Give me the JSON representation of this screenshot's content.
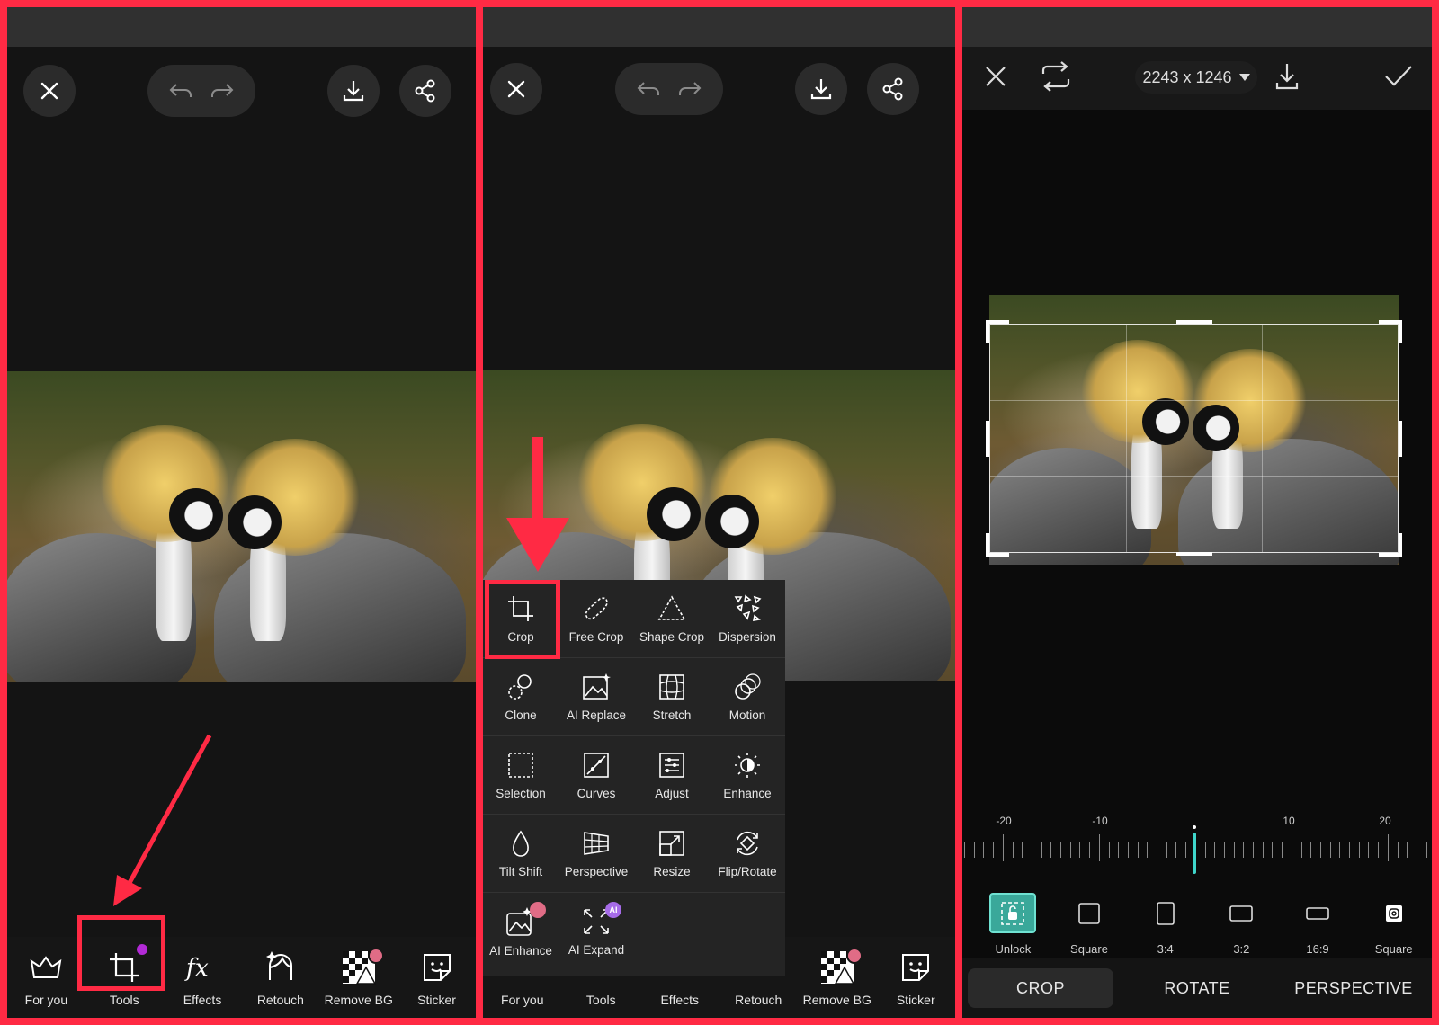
{
  "panel1": {
    "toolbar": [
      {
        "label": "For you",
        "icon": "crown-icon"
      },
      {
        "label": "Tools",
        "icon": "crop-icon"
      },
      {
        "label": "Effects",
        "icon": "fx-icon"
      },
      {
        "label": "Retouch",
        "icon": "face-icon"
      },
      {
        "label": "Remove BG",
        "icon": "checkerboard-icon"
      },
      {
        "label": "Sticker",
        "icon": "sticker-icon"
      }
    ]
  },
  "panel2": {
    "tools": [
      {
        "label": "Crop",
        "icon": "crop-icon"
      },
      {
        "label": "Free Crop",
        "icon": "free-crop-icon"
      },
      {
        "label": "Shape Crop",
        "icon": "triangle-icon"
      },
      {
        "label": "Dispersion",
        "icon": "dispersion-icon"
      },
      {
        "label": "Clone",
        "icon": "clone-icon"
      },
      {
        "label": "AI Replace",
        "icon": "ai-replace-icon"
      },
      {
        "label": "Stretch",
        "icon": "stretch-icon"
      },
      {
        "label": "Motion",
        "icon": "motion-icon"
      },
      {
        "label": "Selection",
        "icon": "selection-icon"
      },
      {
        "label": "Curves",
        "icon": "curves-icon"
      },
      {
        "label": "Adjust",
        "icon": "adjust-icon"
      },
      {
        "label": "Enhance",
        "icon": "enhance-icon"
      },
      {
        "label": "Tilt Shift",
        "icon": "drop-icon"
      },
      {
        "label": "Perspective",
        "icon": "perspective-icon"
      },
      {
        "label": "Resize",
        "icon": "resize-icon"
      },
      {
        "label": "Flip/Rotate",
        "icon": "flip-rotate-icon"
      },
      {
        "label": "AI Enhance",
        "icon": "ai-enhance-icon"
      },
      {
        "label": "AI Expand",
        "icon": "ai-expand-icon"
      }
    ],
    "ai_badge": "AI",
    "toolbar": [
      {
        "label": "For you"
      },
      {
        "label": "Tools"
      },
      {
        "label": "Effects"
      },
      {
        "label": "Retouch"
      },
      {
        "label": "Remove BG"
      },
      {
        "label": "Sticker"
      }
    ]
  },
  "panel3": {
    "image_size": "2243 x 1246",
    "ruler_labels": [
      "-20",
      "-10",
      "10",
      "20"
    ],
    "aspects": [
      {
        "label": "Unlock",
        "active": true
      },
      {
        "label": "Square"
      },
      {
        "label": "3:4"
      },
      {
        "label": "3:2"
      },
      {
        "label": "16:9"
      },
      {
        "label": "Square"
      }
    ],
    "modes": [
      {
        "label": "CROP",
        "active": true
      },
      {
        "label": "ROTATE"
      },
      {
        "label": "PERSPECTIVE"
      }
    ]
  },
  "colors": {
    "annotation_red": "#ff2a44",
    "accent_teal": "#3fd6cb",
    "badge_purple": "#b22ad6"
  }
}
